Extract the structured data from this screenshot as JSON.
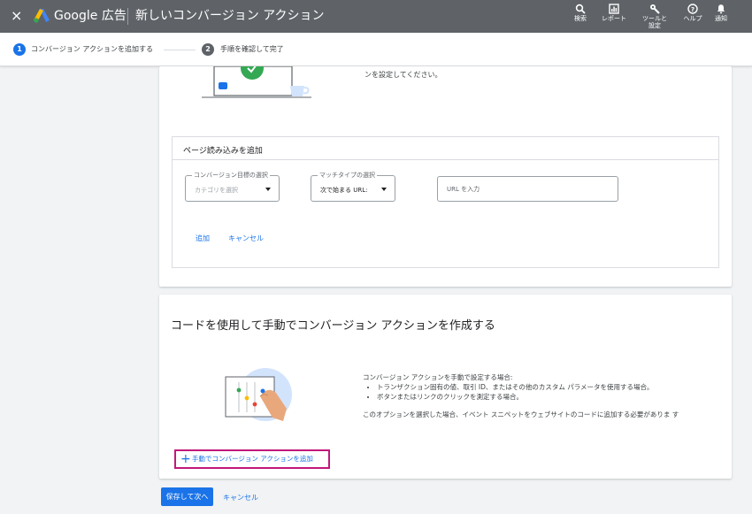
{
  "header": {
    "close_icon": "×",
    "brand": "Google 広告",
    "title": "新しいコンバージョン アクション",
    "tools": [
      {
        "icon": "search-icon",
        "label": "検索"
      },
      {
        "icon": "report-icon",
        "label": "レポート"
      },
      {
        "icon": "wrench-icon",
        "label": "ツールと\n設定"
      },
      {
        "icon": "help-icon",
        "label": "ヘルプ"
      },
      {
        "icon": "bell-icon",
        "label": "通知"
      }
    ]
  },
  "stepper": {
    "steps": [
      {
        "number": "1",
        "label": "コンバージョン アクションを追加する",
        "active": true
      },
      {
        "number": "2",
        "label": "手順を確認して完了",
        "active": false
      }
    ]
  },
  "intro": {
    "text": "ンを設定してください。"
  },
  "page_load": {
    "title": "ページ読み込みを追加",
    "goal_select": {
      "label": "コンバージョン目標の選択",
      "value": "カテゴリを選択"
    },
    "match_select": {
      "label": "マッチタイプの選択",
      "value": "次で始まる URL:"
    },
    "url_placeholder": "URL を入力",
    "add_label": "追加",
    "cancel_label": "キャンセル"
  },
  "manual": {
    "title": "コードを使用して手動でコンバージョン アクションを作成する",
    "lead": "コンバージョン アクションを手動で設定する場合:",
    "bullets": [
      "トランザクション固有の値、取引 ID、またはその他のカスタム パラメータを使用する場合。",
      "ボタンまたはリンクのクリックを測定する場合。"
    ],
    "note": "このオプションを選択した場合、イベント スニペットをウェブサイトのコードに追加する必要がありま す",
    "add_button": "手動でコンバージョン アクションを追加"
  },
  "footer": {
    "save_label": "保存して次へ",
    "cancel_label": "キャンセル"
  },
  "colors": {
    "header_bg": "#5f6368",
    "accent": "#1a73e8",
    "highlight": "#c2187b"
  }
}
